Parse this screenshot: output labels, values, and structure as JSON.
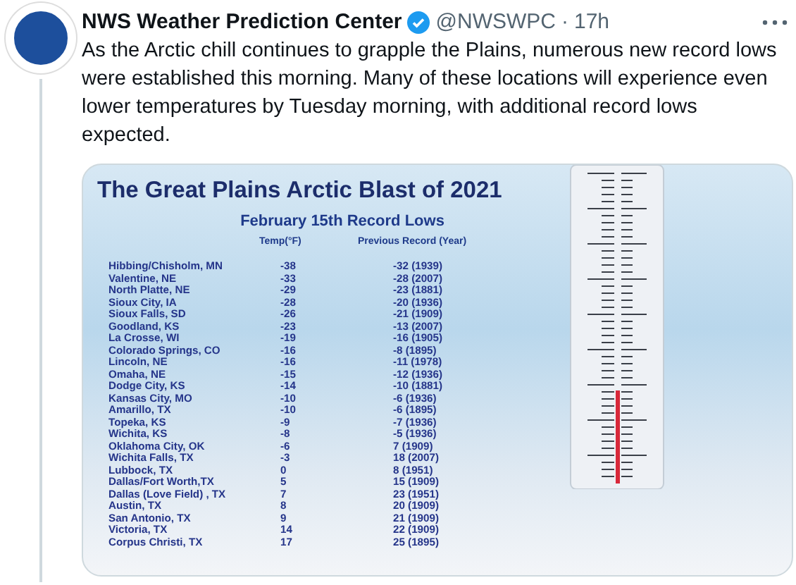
{
  "tweet": {
    "author": "NWS Weather Prediction Center",
    "handle": "@NWSWPC",
    "separator": "·",
    "time": "17h",
    "verified": true,
    "text": "As the Arctic chill continues to grapple the Plains, numerous new record lows were established this morning. Many of these locations will experience even lower temperatures by Tuesday morning, with additional record lows expected."
  },
  "graphic": {
    "title": "The Great Plains Arctic Blast of 2021",
    "subtitle": "February 15th Record Lows",
    "columns": [
      "Temp(°F)",
      "Previous Record (Year)"
    ],
    "rows": [
      {
        "place": "Hibbing/Chisholm, MN",
        "temp": "-38",
        "previous": "-32 (1939)"
      },
      {
        "place": "Valentine, NE",
        "temp": "-33",
        "previous": "-28 (2007)"
      },
      {
        "place": "North Platte, NE",
        "temp": "-29",
        "previous": "-23 (1881)"
      },
      {
        "place": "Sioux City, IA",
        "temp": "-28",
        "previous": "-20 (1936)"
      },
      {
        "place": "Sioux Falls, SD",
        "temp": "-26",
        "previous": "-21 (1909)"
      },
      {
        "place": "Goodland, KS",
        "temp": "-23",
        "previous": "-13 (2007)"
      },
      {
        "place": "La Crosse, WI",
        "temp": "-19",
        "previous": "-16 (1905)"
      },
      {
        "place": "Colorado Springs, CO",
        "temp": "-16",
        "previous": "-8 (1895)"
      },
      {
        "place": "Lincoln, NE",
        "temp": "-16",
        "previous": "-11 (1978)"
      },
      {
        "place": "Omaha, NE",
        "temp": "-15",
        "previous": "-12 (1936)"
      },
      {
        "place": "Dodge City, KS",
        "temp": "-14",
        "previous": "-10 (1881)"
      },
      {
        "place": "Kansas City, MO",
        "temp": "-10",
        "previous": "-6 (1936)"
      },
      {
        "place": "Amarillo, TX",
        "temp": "-10",
        "previous": "-6 (1895)"
      },
      {
        "place": "Topeka, KS",
        "temp": "-9",
        "previous": "-7 (1936)"
      },
      {
        "place": "Wichita, KS",
        "temp": "-8",
        "previous": "-5 (1936)"
      },
      {
        "place": "Oklahoma City, OK",
        "temp": "-6",
        "previous": "7 (1909)"
      },
      {
        "place": "Wichita Falls, TX",
        "temp": "-3",
        "previous": "18 (2007)"
      },
      {
        "place": "Lubbock, TX",
        "temp": "0",
        "previous": "8 (1951)"
      },
      {
        "place": "Dallas/Fort Worth,TX",
        "temp": "5",
        "previous": "15 (1909)"
      },
      {
        "place": "Dallas (Love Field) , TX",
        "temp": "7",
        "previous": "23 (1951)"
      },
      {
        "place": "Austin, TX",
        "temp": "8",
        "previous": "20 (1909)"
      },
      {
        "place": "San Antonio, TX",
        "temp": "9",
        "previous": "21 (1909)"
      },
      {
        "place": "Victoria, TX",
        "temp": "14",
        "previous": "22 (1909)"
      },
      {
        "place": "Corpus Christi, TX",
        "temp": "17",
        "previous": "25 (1895)"
      }
    ]
  }
}
